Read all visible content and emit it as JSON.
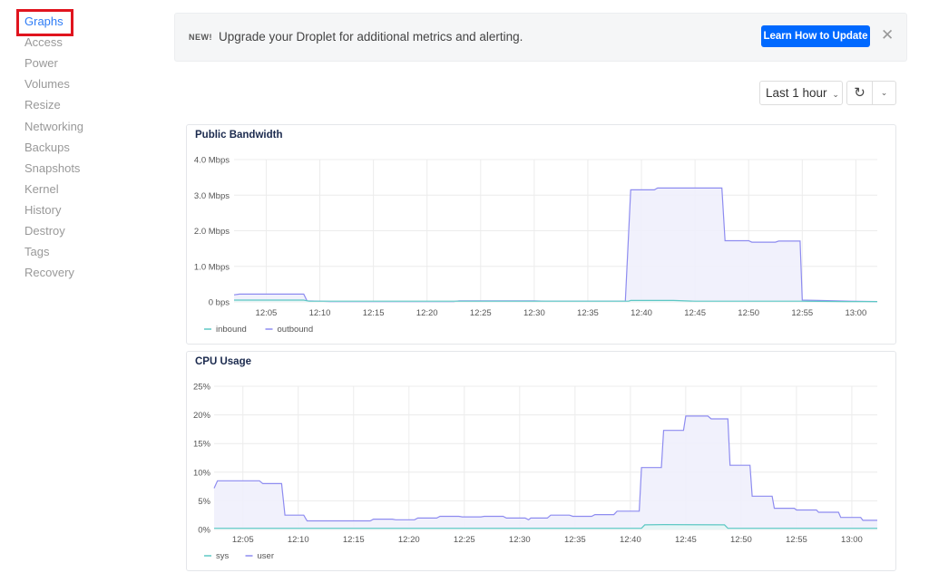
{
  "sidebar": {
    "active": "Graphs",
    "items": [
      {
        "label": "Graphs"
      },
      {
        "label": "Access"
      },
      {
        "label": "Power"
      },
      {
        "label": "Volumes"
      },
      {
        "label": "Resize"
      },
      {
        "label": "Networking"
      },
      {
        "label": "Backups"
      },
      {
        "label": "Snapshots"
      },
      {
        "label": "Kernel"
      },
      {
        "label": "History"
      },
      {
        "label": "Destroy"
      },
      {
        "label": "Tags"
      },
      {
        "label": "Recovery"
      }
    ]
  },
  "banner": {
    "badge": "NEW!",
    "message": "Upgrade your Droplet for additional metrics and alerting.",
    "cta_label": "Learn How to Update",
    "close_icon": "close-icon"
  },
  "controls": {
    "range_label": "Last 1 hour",
    "range_chevron": "⌄",
    "refresh_icon": "↻",
    "menu_chevron": "⌄"
  },
  "colors": {
    "accent": "#0069ff",
    "link_active": "#2e7cf6",
    "highlight_box": "#e0141e",
    "series_outbound": "#8e8cf0",
    "series_inbound": "#5ec8c4",
    "fill": "#f0f0fc"
  },
  "chart_data": [
    {
      "type": "area",
      "title": "Public Bandwidth",
      "x_range": [
        "12:02",
        "13:02"
      ],
      "x_ticks": [
        "12:05",
        "12:10",
        "12:15",
        "12:20",
        "12:25",
        "12:30",
        "12:35",
        "12:40",
        "12:45",
        "12:50",
        "12:55",
        "13:00"
      ],
      "y_ticks": [
        "0 bps",
        "1.0 Mbps",
        "2.0 Mbps",
        "3.0 Mbps",
        "4.0 Mbps"
      ],
      "ylim": [
        0,
        4.0
      ],
      "yunit": "Mbps",
      "grid": true,
      "legend": "bottom-left",
      "series": [
        {
          "name": "inbound",
          "color": "#5ec8c4",
          "points": [
            [
              "12:02",
              0.05
            ],
            [
              "12:08.5",
              0.05
            ],
            [
              "12:09",
              0.02
            ],
            [
              "12:38.8",
              0.02
            ],
            [
              "12:39",
              0.04
            ],
            [
              "12:43",
              0.04
            ],
            [
              "12:45",
              0.02
            ],
            [
              "12:55",
              0.02
            ],
            [
              "12:59",
              0.01
            ],
            [
              "13:02",
              0.01
            ]
          ]
        },
        {
          "name": "outbound",
          "color": "#8e8cf0",
          "points": [
            [
              "12:02",
              0.2
            ],
            [
              "12:02.5",
              0.22
            ],
            [
              "12:08.5",
              0.22
            ],
            [
              "12:08.8",
              0.03
            ],
            [
              "12:11",
              0.01
            ],
            [
              "12:22.5",
              0.01
            ],
            [
              "12:23",
              0.03
            ],
            [
              "12:30",
              0.03
            ],
            [
              "12:31",
              0.02
            ],
            [
              "12:38.5",
              0.02
            ],
            [
              "12:39",
              3.15
            ],
            [
              "12:41.2",
              3.15
            ],
            [
              "12:41.5",
              3.2
            ],
            [
              "12:47.5",
              3.2
            ],
            [
              "12:47.8",
              1.72
            ],
            [
              "12:50",
              1.72
            ],
            [
              "12:50.3",
              1.68
            ],
            [
              "12:52.5",
              1.68
            ],
            [
              "12:52.8",
              1.71
            ],
            [
              "12:54.8",
              1.71
            ],
            [
              "12:55",
              0.05
            ],
            [
              "12:56.5",
              0.04
            ],
            [
              "12:59.5",
              0.02
            ],
            [
              "13:02",
              0.01
            ]
          ]
        }
      ]
    },
    {
      "type": "area",
      "title": "CPU Usage",
      "x_range": [
        "12:02.4",
        "13:02.3"
      ],
      "x_ticks": [
        "12:05",
        "12:10",
        "12:15",
        "12:20",
        "12:25",
        "12:30",
        "12:35",
        "12:40",
        "12:45",
        "12:50",
        "12:55",
        "13:00"
      ],
      "y_ticks": [
        "0%",
        "5%",
        "10%",
        "15%",
        "20%",
        "25%"
      ],
      "ylim": [
        0,
        25
      ],
      "yunit": "%",
      "grid": true,
      "legend": "bottom-left",
      "series": [
        {
          "name": "sys",
          "color": "#5ec8c4",
          "points": [
            [
              "12:02.4",
              0.2
            ],
            [
              "12:41",
              0.2
            ],
            [
              "12:41.3",
              0.8
            ],
            [
              "12:43",
              0.85
            ],
            [
              "12:48.5",
              0.8
            ],
            [
              "12:48.8",
              0.2
            ],
            [
              "13:02.3",
              0.2
            ]
          ]
        },
        {
          "name": "user",
          "color": "#8e8cf0",
          "points": [
            [
              "12:02.4",
              7.2
            ],
            [
              "12:02.7",
              8.5
            ],
            [
              "12:06.5",
              8.5
            ],
            [
              "12:06.8",
              8.0
            ],
            [
              "12:08.5",
              8.0
            ],
            [
              "12:08.8",
              2.5
            ],
            [
              "12:10.5",
              2.5
            ],
            [
              "12:10.8",
              1.5
            ],
            [
              "12:14.5",
              1.5
            ],
            [
              "12:16.5",
              1.5
            ],
            [
              "12:16.8",
              1.8
            ],
            [
              "12:18.5",
              1.8
            ],
            [
              "12:18.8",
              1.7
            ],
            [
              "12:20.5",
              1.7
            ],
            [
              "12:20.8",
              2.0
            ],
            [
              "12:22.5",
              2.0
            ],
            [
              "12:22.8",
              2.3
            ],
            [
              "12:24.5",
              2.3
            ],
            [
              "12:24.8",
              2.2
            ],
            [
              "12:26.5",
              2.2
            ],
            [
              "12:26.8",
              2.3
            ],
            [
              "12:28.5",
              2.3
            ],
            [
              "12:28.8",
              2.0
            ],
            [
              "12:30.5",
              2.0
            ],
            [
              "12:30.8",
              1.7
            ],
            [
              "12:31",
              2.0
            ],
            [
              "12:32.5",
              2.0
            ],
            [
              "12:32.8",
              2.5
            ],
            [
              "12:34.5",
              2.5
            ],
            [
              "12:34.8",
              2.3
            ],
            [
              "12:36.5",
              2.3
            ],
            [
              "12:36.8",
              2.6
            ],
            [
              "12:38.5",
              2.6
            ],
            [
              "12:38.8",
              3.2
            ],
            [
              "12:40.8",
              3.2
            ],
            [
              "12:41",
              10.8
            ],
            [
              "12:42.8",
              10.8
            ],
            [
              "12:43",
              17.3
            ],
            [
              "12:44.8",
              17.3
            ],
            [
              "12:45",
              19.8
            ],
            [
              "12:47",
              19.8
            ],
            [
              "12:47.3",
              19.3
            ],
            [
              "12:48.8",
              19.3
            ],
            [
              "12:49",
              11.2
            ],
            [
              "12:50.8",
              11.2
            ],
            [
              "12:51",
              5.8
            ],
            [
              "12:52.8",
              5.8
            ],
            [
              "12:53",
              3.7
            ],
            [
              "12:54.8",
              3.7
            ],
            [
              "12:55",
              3.4
            ],
            [
              "12:56.8",
              3.4
            ],
            [
              "12:57",
              3.0
            ],
            [
              "12:58.8",
              3.0
            ],
            [
              "12:59",
              2.1
            ],
            [
              "13:00.8",
              2.1
            ],
            [
              "13:01",
              1.6
            ],
            [
              "13:02.3",
              1.6
            ]
          ]
        }
      ]
    }
  ]
}
